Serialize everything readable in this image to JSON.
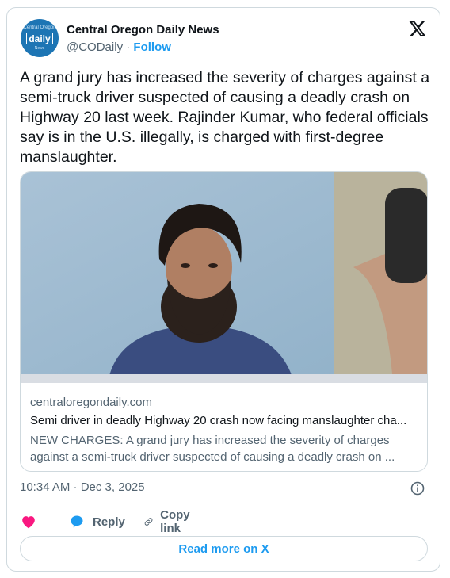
{
  "author": {
    "avatar_top": "Central Oregon",
    "avatar_main": "daily",
    "avatar_bottom": "News",
    "display_name": "Central Oregon Daily News",
    "handle": "@CODaily",
    "separator": "·",
    "follow_label": "Follow"
  },
  "tweet": {
    "text": "A grand jury has increased the severity of charges against a semi-truck driver suspected of causing a deadly crash on Highway 20 last week. Rajinder Kumar, who federal officials say is in the U.S. illegally, is charged with first-degree manslaughter."
  },
  "link_card": {
    "domain": "centraloregondaily.com",
    "title": "Semi driver in deadly Highway 20 crash now facing manslaughter cha...",
    "description": "NEW CHARGES: A grand jury has increased the severity of charges against a semi-truck driver suspected of causing a deadly crash on ..."
  },
  "meta": {
    "timestamp": "10:34 AM · Dec 3, 2025"
  },
  "actions": {
    "reply_label": "Reply",
    "copy_label": "Copy link"
  },
  "footer": {
    "read_more_label": "Read more on X"
  },
  "colors": {
    "accent": "#1d9bf0",
    "heart": "#f91880",
    "muted": "#536471",
    "border": "#cfd9de"
  },
  "icons": [
    "x-logo-icon",
    "info-icon",
    "heart-icon",
    "reply-icon",
    "link-icon"
  ]
}
